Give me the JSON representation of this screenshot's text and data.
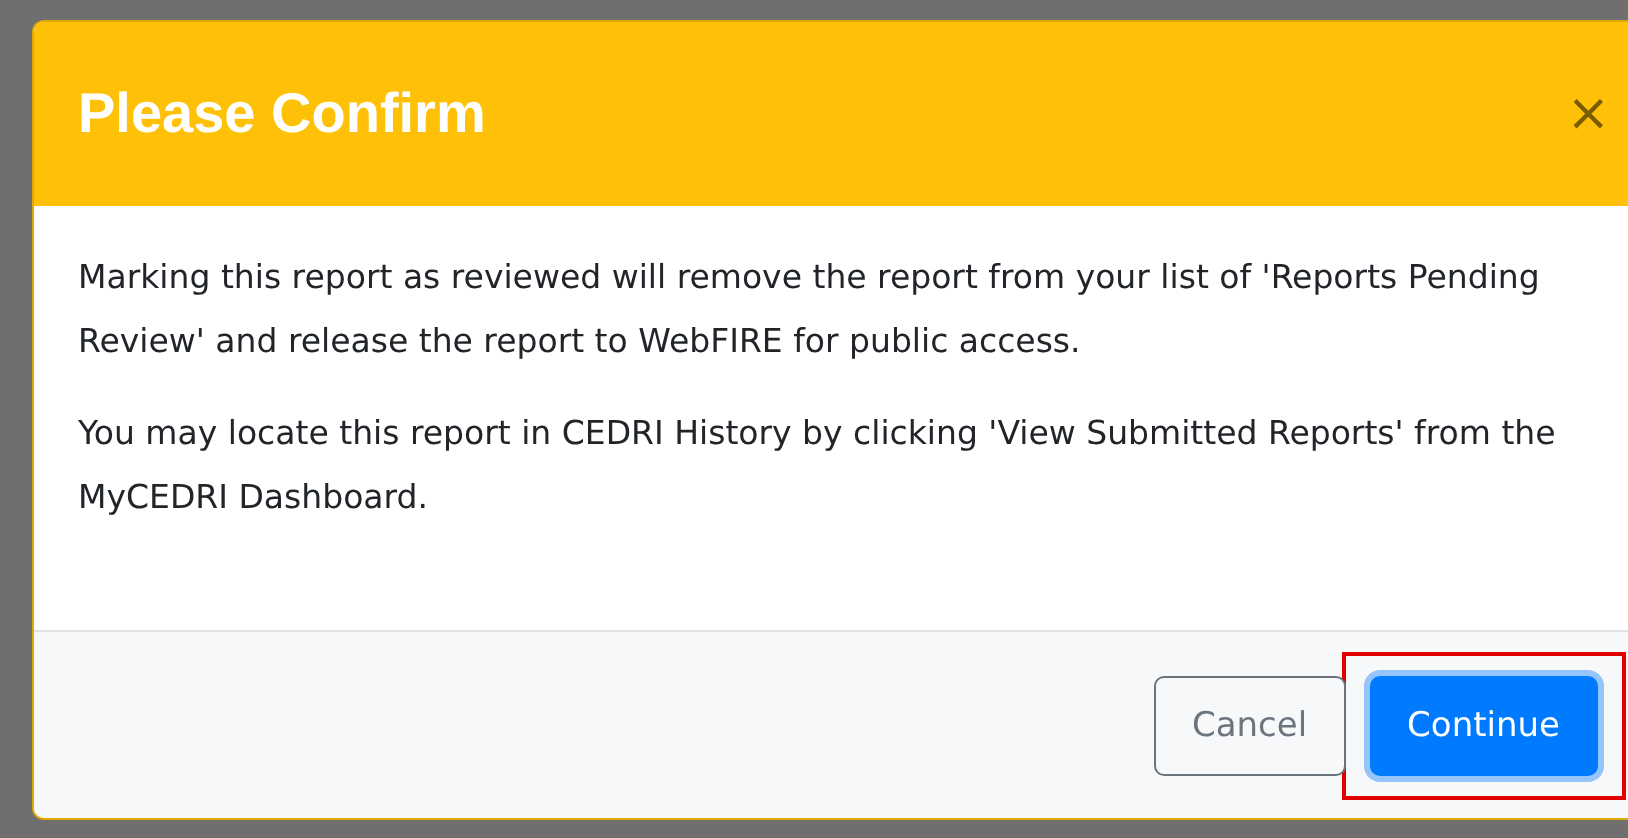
{
  "dialog": {
    "title": "Please Confirm",
    "close": "×",
    "paragraphs": [
      "Marking this report as reviewed will remove the report from your list of 'Reports Pending Review' and release the report to WebFIRE for public access.",
      "You may locate this report in CEDRI History by clicking 'View Submitted Reports' from the MyCEDRI Dashboard."
    ],
    "buttons": [
      {
        "label": "Cancel",
        "kind": "secondary",
        "highlighted": false
      },
      {
        "label": "Continue",
        "kind": "primary",
        "highlighted": true
      }
    ]
  }
}
